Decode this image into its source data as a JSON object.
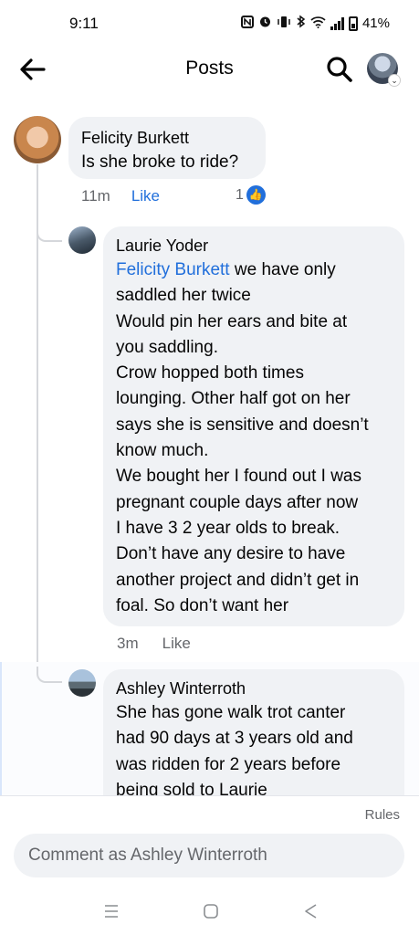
{
  "status_bar": {
    "time": "9:11",
    "battery": "41%",
    "icons": [
      "nfc-icon",
      "alarm-icon",
      "vibrate-icon",
      "bluetooth-icon",
      "wifi-icon",
      "signal-icon",
      "battery-icon"
    ]
  },
  "header": {
    "title": "Posts",
    "icons": [
      "back-arrow-icon",
      "search-icon",
      "profile-avatar"
    ]
  },
  "comments": [
    {
      "author": "Felicity Burkett",
      "text": "Is she broke to ride?",
      "time": "11m",
      "like_label": "Like",
      "reaction_count": "1"
    },
    {
      "author": "Laurie Yoder",
      "mention": "Felicity Burkett",
      "lines": [
        " we have only",
        "saddled her twice",
        "Would pin her ears and bite at",
        "you saddling.",
        "Crow hopped both  times",
        "lounging. Other half got on her",
        "says she is sensitive and doesn’t",
        "know much.",
        "We bought her I found out I was",
        "pregnant couple days after now",
        "I have 3 2 year olds to break.",
        "Don’t have any desire to have",
        "another project and didn’t get in",
        "foal. So don’t want her"
      ],
      "time": "3m",
      "like_label": "Like"
    },
    {
      "author": "Ashley Winterroth",
      "lines": [
        "She has gone walk trot canter",
        "had 90 days at 3 years old and",
        "was ridden for 2 years before",
        "being sold to Laurie"
      ]
    }
  ],
  "composer": {
    "rules_label": "Rules",
    "placeholder": "Comment as Ashley Winterroth"
  },
  "colors": {
    "accent": "#216fdb",
    "bubble": "#f0f2f5",
    "meta": "#65676b"
  }
}
